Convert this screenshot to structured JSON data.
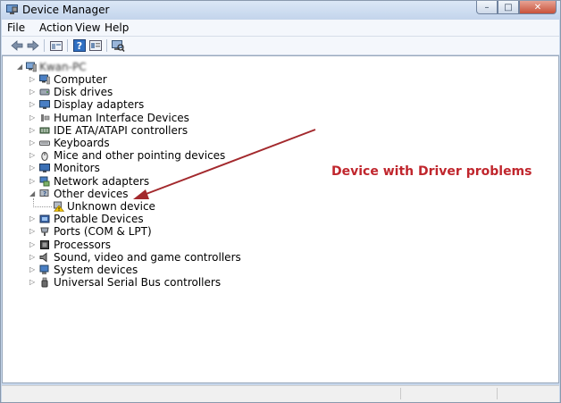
{
  "window": {
    "title": "Device Manager",
    "caption_buttons": [
      "minimize",
      "maximize",
      "close"
    ]
  },
  "menu": {
    "file": "File",
    "action": "Action",
    "view": "View",
    "help": "Help"
  },
  "toolbar": {
    "icons": [
      "back-icon",
      "forward-icon",
      "up-icon",
      "help-icon",
      "properties-icon",
      "scan-hardware-icon"
    ]
  },
  "tree": {
    "root": "Kwan-PC",
    "items": [
      {
        "label": "Computer",
        "icon": "computer-icon"
      },
      {
        "label": "Disk drives",
        "icon": "disk-icon"
      },
      {
        "label": "Display adapters",
        "icon": "display-icon"
      },
      {
        "label": "Human Interface Devices",
        "icon": "hid-icon"
      },
      {
        "label": "IDE ATA/ATAPI controllers",
        "icon": "ide-icon"
      },
      {
        "label": "Keyboards",
        "icon": "keyboard-icon"
      },
      {
        "label": "Mice and other pointing devices",
        "icon": "mouse-icon"
      },
      {
        "label": "Monitors",
        "icon": "monitor-icon"
      },
      {
        "label": "Network adapters",
        "icon": "network-icon"
      },
      {
        "label": "Other devices",
        "icon": "other-devices-icon"
      },
      {
        "label": "Unknown device",
        "icon": "warning-device-icon"
      },
      {
        "label": "Portable Devices",
        "icon": "portable-icon"
      },
      {
        "label": "Ports (COM & LPT)",
        "icon": "port-icon"
      },
      {
        "label": "Processors",
        "icon": "processor-icon"
      },
      {
        "label": "Sound, video and game controllers",
        "icon": "sound-icon"
      },
      {
        "label": "System devices",
        "icon": "system-icon"
      },
      {
        "label": "Universal Serial Bus controllers",
        "icon": "usb-icon"
      }
    ]
  },
  "annotation": {
    "text": "Device with Driver problems",
    "color": "#c0262d"
  }
}
